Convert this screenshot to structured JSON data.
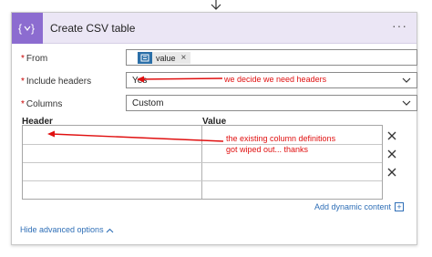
{
  "card": {
    "title": "Create CSV table",
    "icon": "curly-braces-icon",
    "more_label": "···"
  },
  "fields": {
    "from": {
      "required_mark": "*",
      "label": "From",
      "token_label": "value",
      "token_icon": "office-app-icon",
      "token_remove": "×"
    },
    "include_headers": {
      "required_mark": "*",
      "label": "Include headers",
      "value": "Yes"
    },
    "columns": {
      "required_mark": "*",
      "label": "Columns",
      "value": "Custom"
    }
  },
  "table": {
    "header_col": "Header",
    "value_col": "Value",
    "row_count": 4
  },
  "links": {
    "add_dynamic": "Add dynamic content",
    "add_dynamic_icon": "+",
    "hide_advanced": "Hide advanced options"
  },
  "annotations": {
    "headers_note": "we decide we need headers",
    "columns_note_line1": "the existing column definitions",
    "columns_note_line2": "got wiped out...  thanks"
  },
  "colors": {
    "accent": "#8c6cd0",
    "header_bg": "#ebe6f5",
    "link": "#2f6fb7",
    "annotation": "#e01010"
  }
}
